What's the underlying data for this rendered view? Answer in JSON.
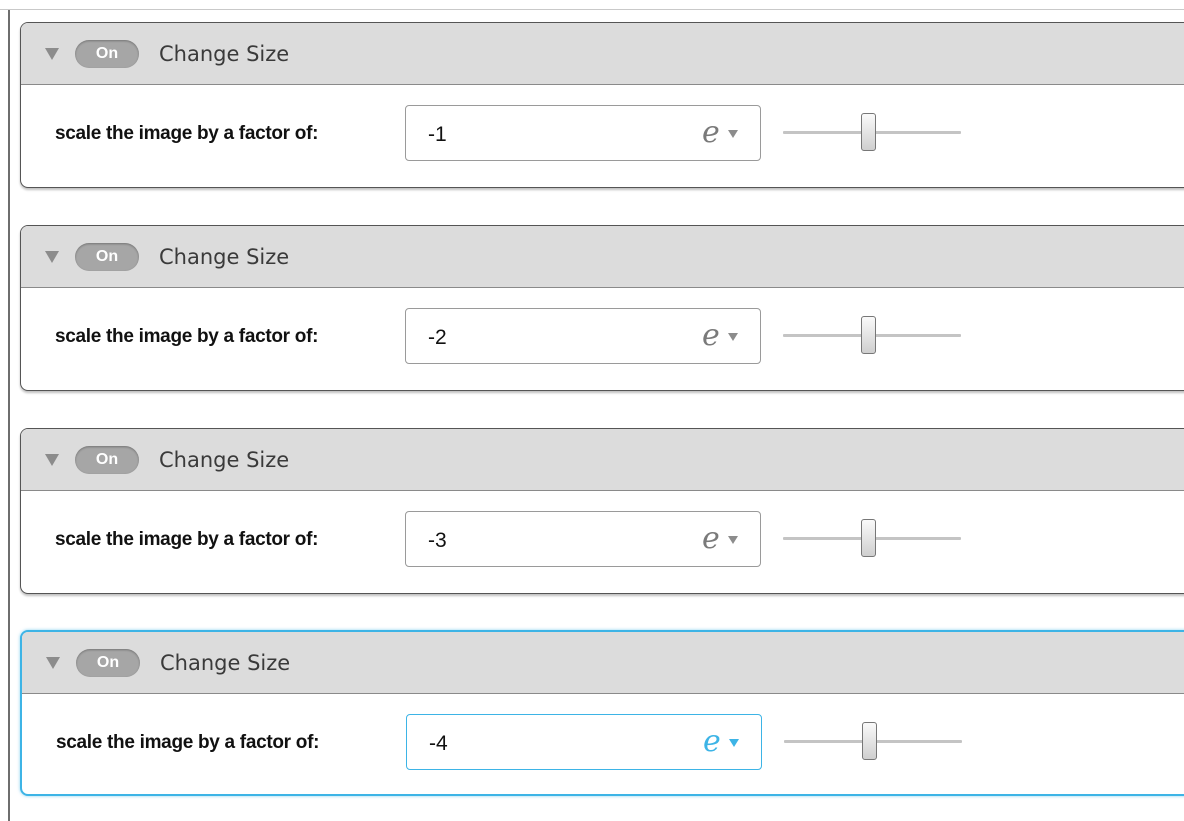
{
  "blocks": [
    {
      "title": "Change Size",
      "toggle_label": "On",
      "param_label": "scale the image by a factor of:",
      "value": "-1",
      "expression_icon": "e",
      "slider_level": 0.5,
      "selected": false
    },
    {
      "title": "Change Size",
      "toggle_label": "On",
      "param_label": "scale the image by a factor of:",
      "value": "-2",
      "expression_icon": "e",
      "slider_level": 0.5,
      "selected": false
    },
    {
      "title": "Change Size",
      "toggle_label": "On",
      "param_label": "scale the image by a factor of:",
      "value": "-3",
      "expression_icon": "e",
      "slider_level": 0.5,
      "selected": false
    },
    {
      "title": "Change Size",
      "toggle_label": "On",
      "param_label": "scale the image by a factor of:",
      "value": "-4",
      "expression_icon": "e",
      "slider_level": 0.5,
      "selected": true
    }
  ],
  "colors": {
    "selection_accent": "#3db4e6",
    "header_background": "#dcdcdc",
    "toggle_background": "#a6a6a6"
  }
}
